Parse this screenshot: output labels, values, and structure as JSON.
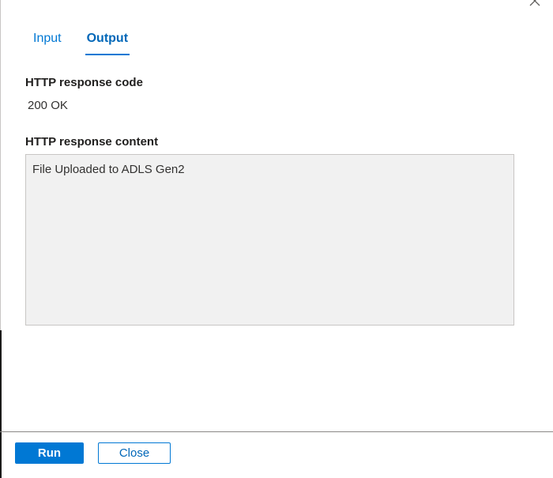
{
  "tabs": [
    {
      "label": "Input",
      "active": false
    },
    {
      "label": "Output",
      "active": true
    }
  ],
  "output": {
    "response_code_label": "HTTP response code",
    "response_code_value": "200 OK",
    "response_content_label": "HTTP response content",
    "response_content_value": "File Uploaded to ADLS Gen2"
  },
  "footer": {
    "run_label": "Run",
    "close_label": "Close"
  },
  "icons": {
    "dismiss": "close-icon"
  },
  "colors": {
    "accent": "#0078d4",
    "content_box_bg": "#f1f1f1"
  }
}
